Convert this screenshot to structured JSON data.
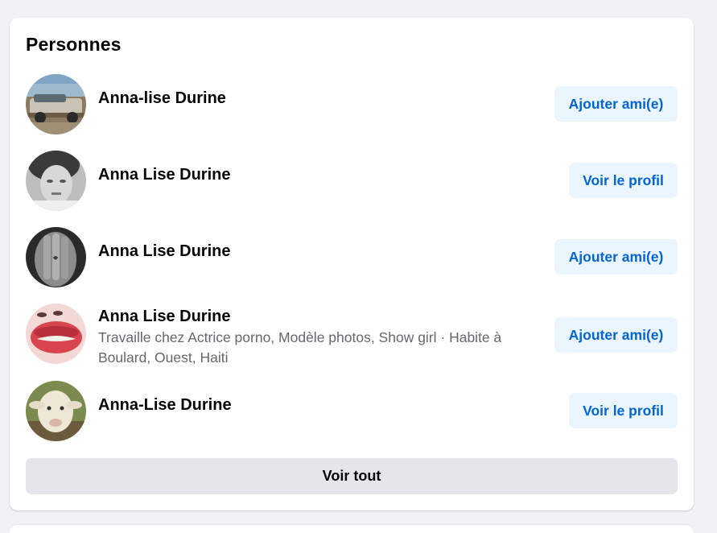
{
  "section": {
    "title": "Personnes",
    "see_all_label": "Voir tout"
  },
  "people": [
    {
      "name": "Anna-lise Durine",
      "subtitle": "",
      "action_label": "Ajouter ami(e)",
      "action_type": "add-friend"
    },
    {
      "name": "Anna Lise Durine",
      "subtitle": "",
      "action_label": "Voir le profil",
      "action_type": "view-profile"
    },
    {
      "name": "Anna Lise Durine",
      "subtitle": "",
      "action_label": "Ajouter ami(e)",
      "action_type": "add-friend"
    },
    {
      "name": "Anna Lise Durine",
      "subtitle": "Travaille chez Actrice porno, Modèle photos, Show girl · Habite à Boulard, Ouest, Haiti",
      "action_label": "Ajouter ami(e)",
      "action_type": "add-friend"
    },
    {
      "name": "Anna-Lise Durine",
      "subtitle": "",
      "action_label": "Voir le profil",
      "action_type": "view-profile"
    }
  ],
  "colors": {
    "page_background": "#f0f2f5",
    "card_background": "#ffffff",
    "primary_button_bg": "#ebf5ff",
    "primary_button_text": "#0064d1",
    "secondary_button_bg": "#e4e6eb",
    "text_primary": "#050505",
    "text_secondary": "#65676b"
  }
}
